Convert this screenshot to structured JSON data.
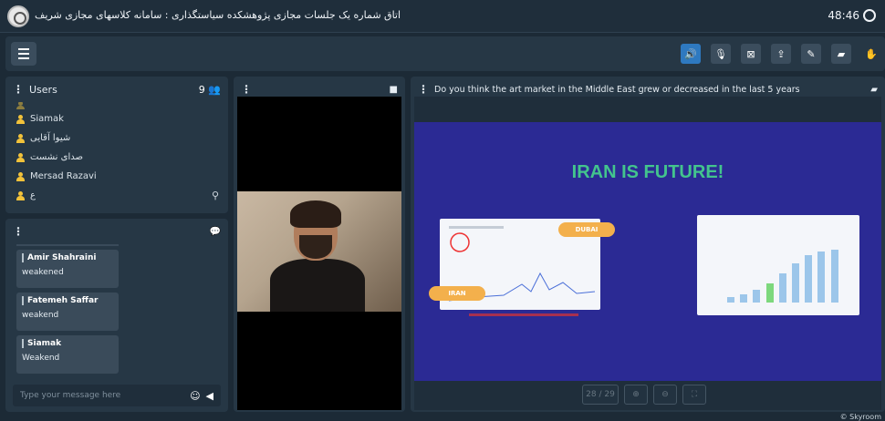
{
  "titlebar": {
    "title": "اتاق شماره یک جلسات مجازی پژوهشکده سیاستگذاری : سامانه کلاسهای مجازی شریف",
    "timer": "48:46"
  },
  "toolbar": {
    "tools": [
      {
        "name": "speaker-icon",
        "glyph": "🔊",
        "active": true
      },
      {
        "name": "mic-off-icon",
        "glyph": "🎙"
      },
      {
        "name": "camera-off-icon",
        "glyph": "⊠"
      },
      {
        "name": "screen-share-icon",
        "glyph": "⇪"
      },
      {
        "name": "pen-icon",
        "glyph": "✎"
      },
      {
        "name": "folder-icon",
        "glyph": "▰"
      },
      {
        "name": "raise-hand-icon",
        "glyph": "✋",
        "plain": true
      }
    ]
  },
  "users": {
    "title": "Users",
    "count": "9",
    "list": [
      "Siamak",
      "شیوا آقایی",
      "صدای نشست",
      "Mersad Razavi",
      "ع"
    ]
  },
  "chat": {
    "messages": [
      {
        "name": "Amir Shahraini",
        "text": "weakened"
      },
      {
        "name": "Fatemeh Saffar",
        "text": "weakend"
      },
      {
        "name": "Siamak",
        "text": "Weakend"
      }
    ],
    "placeholder": "Type your message here"
  },
  "slides": {
    "question": "Do you think the art market in the Middle East grew or decreased in the last 5 years",
    "slide_title": "IRAN IS FUTURE!",
    "label_dubai": "DUBAI",
    "label_iran": "IRAN",
    "page_indicator": "28 / 29",
    "bar_levels": [
      0.08,
      0.12,
      0.18,
      0.28,
      0.42,
      0.56,
      0.68,
      0.74,
      0.76
    ]
  },
  "footer": {
    "text": "© Skyroom"
  },
  "colors": {
    "accent": "#2e79c0",
    "slide_bg": "#2b2a94",
    "slide_title": "#43c48d",
    "pill": "#f3b04c",
    "user_icon": "#f2c23a"
  }
}
